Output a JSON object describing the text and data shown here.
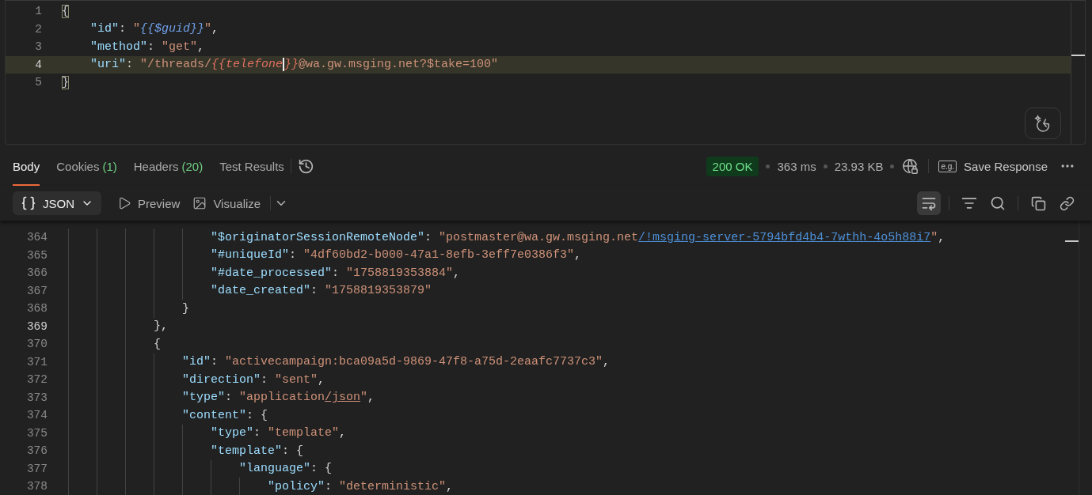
{
  "request_editor": {
    "lines": [
      {
        "number": "1",
        "active": false,
        "segments": [
          {
            "kind": "punct",
            "text": "{",
            "matched": true
          }
        ]
      },
      {
        "number": "2",
        "active": false,
        "segments": [
          {
            "kind": "key",
            "text": "    \"id\""
          },
          {
            "kind": "punct",
            "text": ": "
          },
          {
            "kind": "str",
            "text": "\""
          },
          {
            "kind": "var",
            "text": "{{$guid}}"
          },
          {
            "kind": "str",
            "text": "\""
          },
          {
            "kind": "punct",
            "text": ","
          }
        ]
      },
      {
        "number": "3",
        "active": false,
        "segments": [
          {
            "kind": "key",
            "text": "    \"method\""
          },
          {
            "kind": "punct",
            "text": ": "
          },
          {
            "kind": "str",
            "text": "\"get\""
          },
          {
            "kind": "punct",
            "text": ","
          }
        ]
      },
      {
        "number": "4",
        "active": true,
        "segments": [
          {
            "kind": "key",
            "text": "    \"uri\""
          },
          {
            "kind": "punct",
            "text": ": "
          },
          {
            "kind": "str",
            "text": "\"/threads/"
          },
          {
            "kind": "unresolved",
            "text": "{{telefone",
            "caret": true
          },
          {
            "kind": "unresolved",
            "text": "}}"
          },
          {
            "kind": "str",
            "text": "@wa.gw.msging.net?$take=100\""
          }
        ]
      },
      {
        "number": "5",
        "active": false,
        "segments": [
          {
            "kind": "punct",
            "text": "}",
            "matched": true
          }
        ]
      }
    ]
  },
  "response_tabs": [
    {
      "label": "Body",
      "selected": true
    },
    {
      "label": "Cookies",
      "count": "(1)",
      "selected": false
    },
    {
      "label": "Headers",
      "count": "(20)",
      "selected": false
    },
    {
      "label": "Test Results",
      "selected": false
    }
  ],
  "status": {
    "code": "200 OK",
    "time": "363 ms",
    "size": "23.93 KB"
  },
  "save_response": {
    "badge": "e.g.",
    "label": "Save Response"
  },
  "format": {
    "label": "JSON"
  },
  "view_options": [
    {
      "kind": "preview",
      "label": "Preview"
    },
    {
      "kind": "visualize",
      "label": "Visualize"
    }
  ],
  "wrap_lines": {
    "on": true
  },
  "response_body": {
    "indent_guides": true,
    "lines": [
      {
        "number": "364",
        "active": false,
        "segments": [
          {
            "kind": "key",
            "text": "                    \"$originatorSessionRemoteNode\""
          },
          {
            "kind": "punct",
            "text": ": "
          },
          {
            "kind": "str",
            "text": "\"postmaster@wa.gw.msging.net"
          },
          {
            "kind": "link",
            "text": "/!msging-server-5794bfd4b4-7wthh-4o5h88i7"
          },
          {
            "kind": "str",
            "text": "\""
          },
          {
            "kind": "punct",
            "text": ","
          }
        ]
      },
      {
        "number": "365",
        "active": false,
        "segments": [
          {
            "kind": "key",
            "text": "                    \"#uniqueId\""
          },
          {
            "kind": "punct",
            "text": ": "
          },
          {
            "kind": "str",
            "text": "\"4df60bd2-b000-47a1-8efb-3eff7e0386f3\""
          },
          {
            "kind": "punct",
            "text": ","
          }
        ]
      },
      {
        "number": "366",
        "active": false,
        "segments": [
          {
            "kind": "key",
            "text": "                    \"#date_processed\""
          },
          {
            "kind": "punct",
            "text": ": "
          },
          {
            "kind": "str",
            "text": "\"1758819353884\""
          },
          {
            "kind": "punct",
            "text": ","
          }
        ]
      },
      {
        "number": "367",
        "active": false,
        "segments": [
          {
            "kind": "key",
            "text": "                    \"date_created\""
          },
          {
            "kind": "punct",
            "text": ": "
          },
          {
            "kind": "str",
            "text": "\"1758819353879\""
          }
        ]
      },
      {
        "number": "368",
        "active": false,
        "segments": [
          {
            "kind": "punct",
            "text": "                }"
          }
        ]
      },
      {
        "number": "369",
        "active": true,
        "segments": [
          {
            "kind": "punct",
            "text": "            },"
          }
        ]
      },
      {
        "number": "370",
        "active": false,
        "segments": [
          {
            "kind": "punct",
            "text": "            {"
          }
        ]
      },
      {
        "number": "371",
        "active": false,
        "segments": [
          {
            "kind": "key",
            "text": "                \"id\""
          },
          {
            "kind": "punct",
            "text": ": "
          },
          {
            "kind": "str",
            "text": "\"activecampaign:bca09a5d-9869-47f8-a75d-2eaafc7737c3\""
          },
          {
            "kind": "punct",
            "text": ","
          }
        ]
      },
      {
        "number": "372",
        "active": false,
        "segments": [
          {
            "kind": "key",
            "text": "                \"direction\""
          },
          {
            "kind": "punct",
            "text": ": "
          },
          {
            "kind": "str",
            "text": "\"sent\""
          },
          {
            "kind": "punct",
            "text": ","
          }
        ]
      },
      {
        "number": "373",
        "active": false,
        "segments": [
          {
            "kind": "key",
            "text": "                \"type\""
          },
          {
            "kind": "punct",
            "text": ": "
          },
          {
            "kind": "str",
            "text": "\"application"
          },
          {
            "kind": "strlink",
            "text": "/json"
          },
          {
            "kind": "str",
            "text": "\""
          },
          {
            "kind": "punct",
            "text": ","
          }
        ]
      },
      {
        "number": "374",
        "active": false,
        "segments": [
          {
            "kind": "key",
            "text": "                \"content\""
          },
          {
            "kind": "punct",
            "text": ": {"
          }
        ]
      },
      {
        "number": "375",
        "active": false,
        "segments": [
          {
            "kind": "key",
            "text": "                    \"type\""
          },
          {
            "kind": "punct",
            "text": ": "
          },
          {
            "kind": "str",
            "text": "\"template\""
          },
          {
            "kind": "punct",
            "text": ","
          }
        ]
      },
      {
        "number": "376",
        "active": false,
        "segments": [
          {
            "kind": "key",
            "text": "                    \"template\""
          },
          {
            "kind": "punct",
            "text": ": {"
          }
        ]
      },
      {
        "number": "377",
        "active": false,
        "segments": [
          {
            "kind": "key",
            "text": "                        \"language\""
          },
          {
            "kind": "punct",
            "text": ": {"
          }
        ]
      },
      {
        "number": "378",
        "active": false,
        "segments": [
          {
            "kind": "key",
            "text": "                            \"policy\""
          },
          {
            "kind": "punct",
            "text": ": "
          },
          {
            "kind": "str",
            "text": "\"deterministic\""
          },
          {
            "kind": "punct",
            "text": ","
          }
        ]
      }
    ]
  }
}
